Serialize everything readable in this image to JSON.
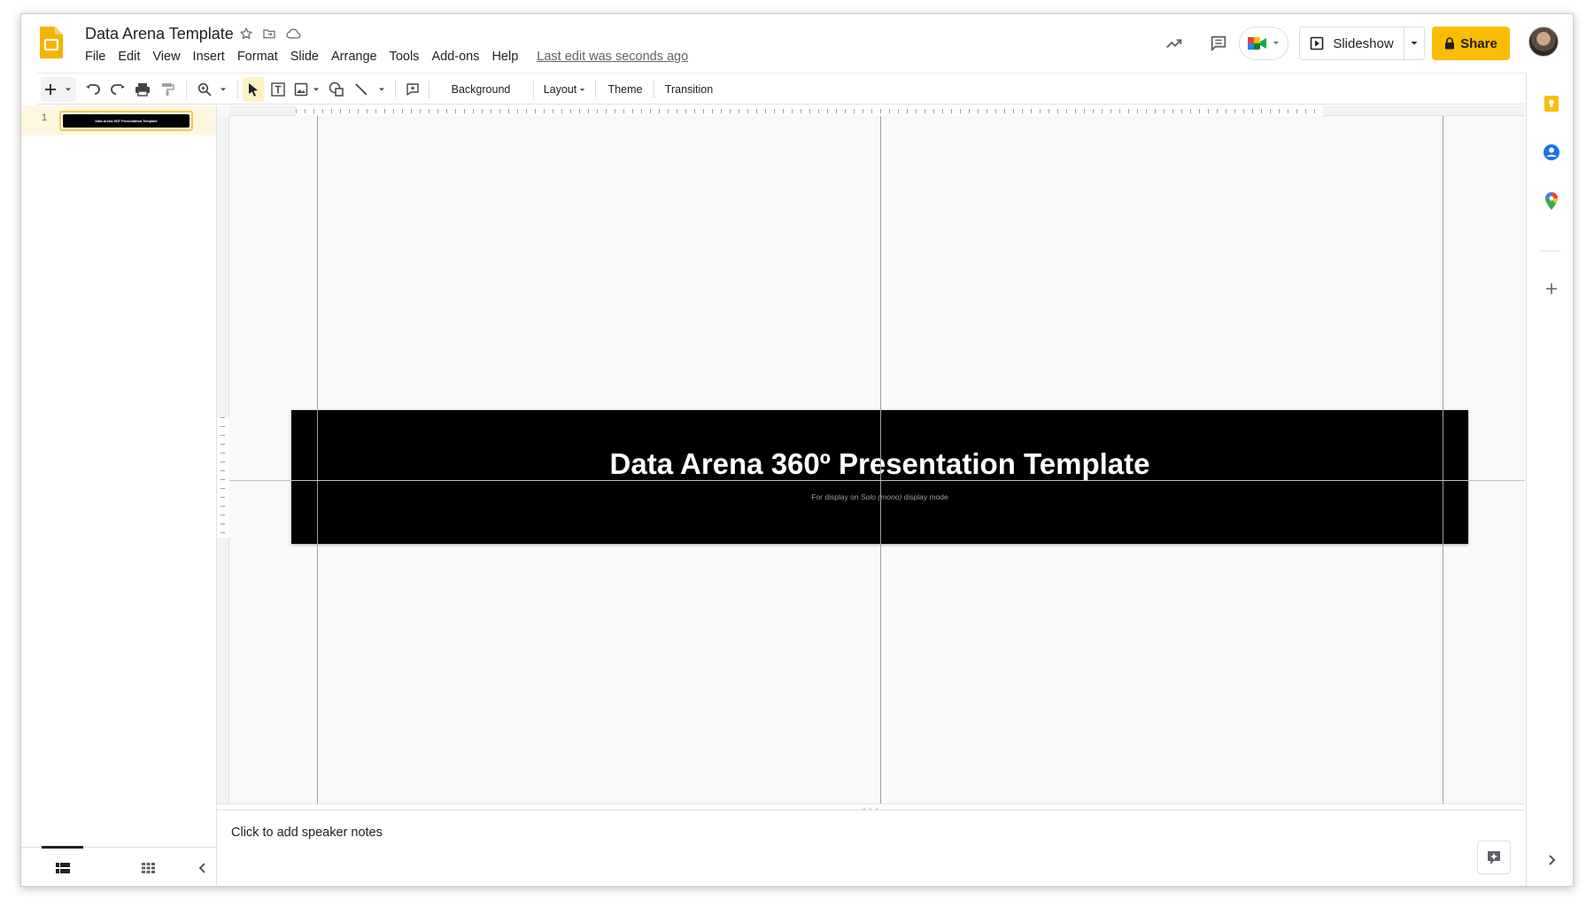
{
  "app": {
    "doc_title": "Data Arena Template",
    "last_edit": "Last edit was seconds ago"
  },
  "menu": [
    "File",
    "Edit",
    "View",
    "Insert",
    "Format",
    "Slide",
    "Arrange",
    "Tools",
    "Add-ons",
    "Help"
  ],
  "header_actions": {
    "slideshow_label": "Slideshow",
    "share_label": "Share"
  },
  "toolbar": {
    "background_label": "Background",
    "layout_label": "Layout",
    "theme_label": "Theme",
    "transition_label": "Transition"
  },
  "filmstrip": {
    "slides": [
      {
        "number": "1",
        "thumb_title": "Data Arena 360º Presentation Template"
      }
    ]
  },
  "slide": {
    "title": "Data Arena 360º Presentation Template",
    "subtitle_pre": "For display on ",
    "subtitle_em": "Solo (mono)",
    "subtitle_post": " display mode",
    "background_color": "#000000"
  },
  "notes": {
    "placeholder": "Click to add speaker notes"
  },
  "colors": {
    "brand_slides": "#F4B400",
    "share_button": "#FBBC04",
    "selection_highlight": "#FEF7E0"
  }
}
